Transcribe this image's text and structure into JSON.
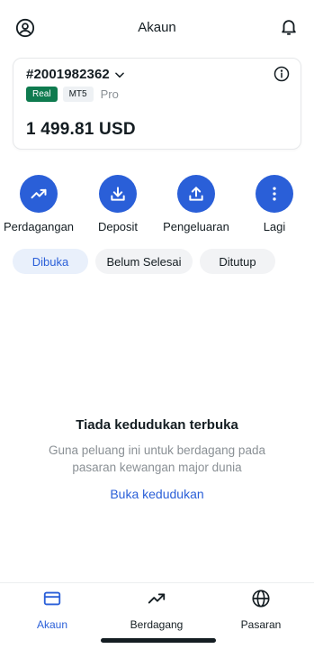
{
  "header": {
    "title": "Akaun",
    "left_icon": "profile-icon",
    "right_icon": "bell-icon"
  },
  "account": {
    "number": "#2001982362",
    "badges": {
      "real": "Real",
      "platform": "MT5",
      "type": "Pro"
    },
    "balance": "1 499.81 USD"
  },
  "actions": [
    {
      "label": "Perdagangan",
      "icon": "trend-up-icon"
    },
    {
      "label": "Deposit",
      "icon": "download-icon"
    },
    {
      "label": "Pengeluaran",
      "icon": "upload-icon"
    },
    {
      "label": "Lagi",
      "icon": "more-vertical-icon"
    }
  ],
  "tabs": [
    {
      "label": "Dibuka",
      "active": true
    },
    {
      "label": "Belum Selesai",
      "active": false
    },
    {
      "label": "Ditutup",
      "active": false
    }
  ],
  "empty_state": {
    "title": "Tiada kedudukan terbuka",
    "description": "Guna peluang ini untuk berdagang pada pasaran kewangan major dunia",
    "link": "Buka kedudukan"
  },
  "bottom_nav": [
    {
      "label": "Akaun",
      "icon": "card-icon",
      "active": true
    },
    {
      "label": "Berdagang",
      "icon": "trend-up-icon",
      "active": false
    },
    {
      "label": "Pasaran",
      "icon": "globe-icon",
      "active": false
    }
  ],
  "colors": {
    "accent": "#2a5fd8",
    "real_badge": "#0f7b4f",
    "text": "#141d22",
    "muted": "#8a9095"
  }
}
